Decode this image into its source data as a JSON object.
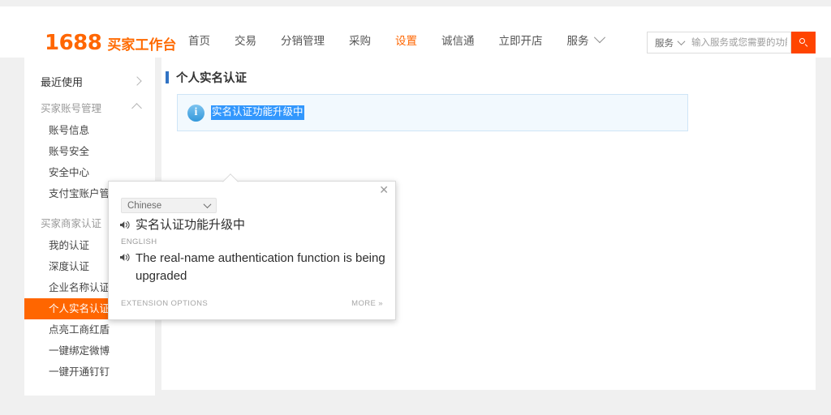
{
  "header": {
    "logo_number": "1688",
    "logo_text": "买家工作台",
    "nav": [
      {
        "label": "首页",
        "active": false
      },
      {
        "label": "交易",
        "active": false
      },
      {
        "label": "分销管理",
        "active": false
      },
      {
        "label": "采购",
        "active": false
      },
      {
        "label": "设置",
        "active": true
      },
      {
        "label": "诚信通",
        "active": false
      },
      {
        "label": "立即开店",
        "active": false
      },
      {
        "label": "服务",
        "active": false
      }
    ],
    "nav_more_icon": "chevron-down-icon",
    "search": {
      "scope_label": "服务",
      "scope_icon": "chevron-down-icon",
      "placeholder": "输入服务或您需要的功能",
      "value": "",
      "button_icon": "search-icon"
    }
  },
  "sidebar": {
    "groups": [
      {
        "label": "最近使用",
        "icon": "chevron-right-icon",
        "muted": false,
        "items": []
      },
      {
        "label": "买家账号管理",
        "icon": "chevron-up-icon",
        "muted": true,
        "items": [
          "账号信息",
          "账号安全",
          "安全中心",
          "支付宝账户管理"
        ]
      },
      {
        "label": "买家商家认证",
        "icon": "",
        "muted": true,
        "items": [
          "我的认证",
          "深度认证",
          "企业名称认证",
          "个人实名认证",
          "点亮工商红盾",
          "一键绑定微博",
          "一键开通钉钉"
        ]
      }
    ],
    "active_item": "个人实名认证"
  },
  "content": {
    "page_title": "个人实名认证",
    "title_bar_color": "#3173c4",
    "notice": {
      "icon": "info-icon",
      "text": "实名认证功能升级中",
      "selected": true,
      "selection_color": "#3297fd",
      "background": "#f2f9fe",
      "border_color": "#cfe5f7"
    }
  },
  "translate_popup": {
    "close_icon": "close-icon",
    "language_select": {
      "value": "Chinese",
      "icon": "chevron-down-icon"
    },
    "source": {
      "speaker_icon": "speaker-icon",
      "text": "实名认证功能升级中"
    },
    "target_language_label": "ENGLISH",
    "target": {
      "speaker_icon": "speaker-icon",
      "text": "The real-name authentication function is being upgraded"
    },
    "footer": {
      "extension_options": "EXTENSION OPTIONS",
      "more": "MORE »"
    }
  },
  "colors": {
    "brand_orange": "#ff6600",
    "search_button": "#ff4400",
    "page_background": "#f0f0f0"
  }
}
